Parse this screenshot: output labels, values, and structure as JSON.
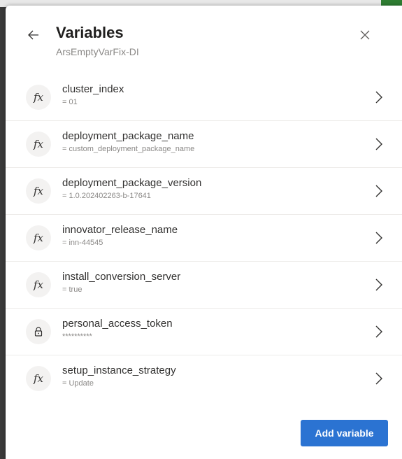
{
  "panel": {
    "title": "Variables",
    "subtitle": "ArsEmptyVarFix-DI"
  },
  "icons": {
    "back": "arrow-left-icon",
    "close": "close-icon",
    "function": "function-fx-icon",
    "lock": "lock-icon",
    "chevron": "chevron-right-icon"
  },
  "variables": [
    {
      "name": "cluster_index",
      "value": "= 01",
      "icon": "fx"
    },
    {
      "name": "deployment_package_name",
      "value": "= custom_deployment_package_name",
      "icon": "fx"
    },
    {
      "name": "deployment_package_version",
      "value": "= 1.0.202402263-b-17641",
      "icon": "fx"
    },
    {
      "name": "innovator_release_name",
      "value": "= inn-44545",
      "icon": "fx"
    },
    {
      "name": "install_conversion_server",
      "value": "= true",
      "icon": "fx"
    },
    {
      "name": "personal_access_token",
      "value": "**********",
      "icon": "lock"
    },
    {
      "name": "setup_instance_strategy",
      "value": "= Update",
      "icon": "fx"
    }
  ],
  "footer": {
    "add_label": "Add variable"
  },
  "colors": {
    "primary": "#2b73d2",
    "title": "#201f1e",
    "secondary_text": "#8a8886"
  }
}
